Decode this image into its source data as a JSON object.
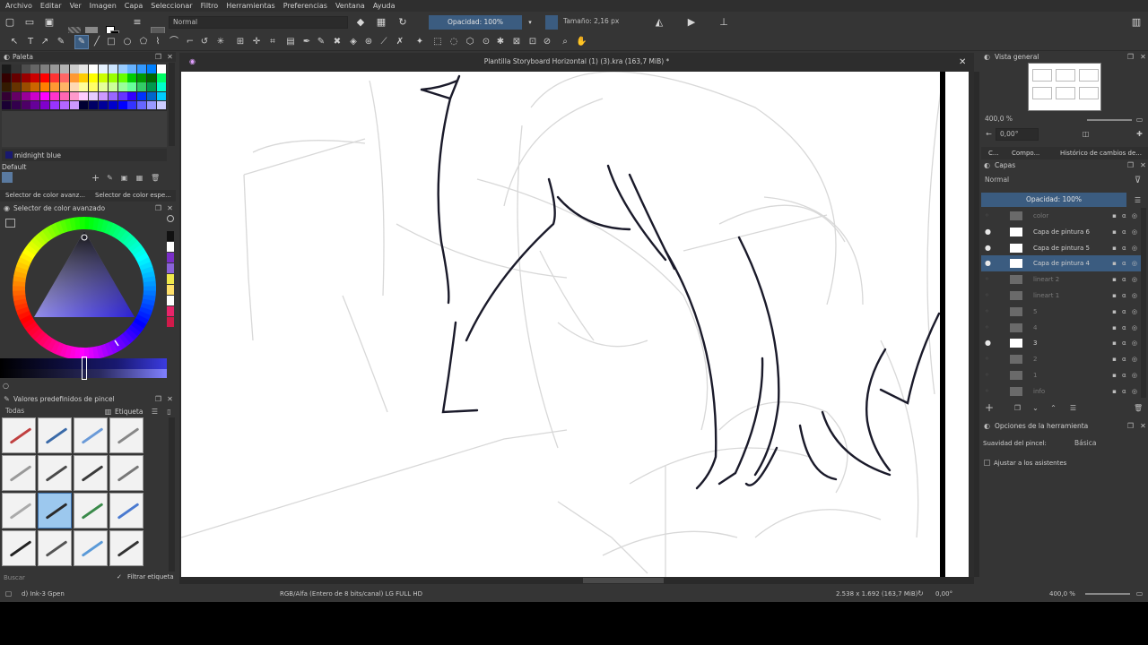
{
  "menu": [
    "Archivo",
    "Editar",
    "Ver",
    "Imagen",
    "Capa",
    "Seleccionar",
    "Filtro",
    "Herramientas",
    "Preferencias",
    "Ventana",
    "Ayuda"
  ],
  "toolbar": {
    "blend_mode": "Normal",
    "opacity": "Opacidad: 100%",
    "size": "Tamaño: 2,16 px"
  },
  "document": {
    "title": "Plantilla Storyboard Horizontal (1) (3).kra (163,7 MiB) *",
    "close": "✕"
  },
  "palette": {
    "title": "Paleta",
    "color_name": "midnight blue",
    "set_name": "Default",
    "swatch_rows": [
      [
        "#1a1a1a",
        "#333333",
        "#4d4d4d",
        "#666666",
        "#808080",
        "#999999",
        "#b3b3b3",
        "#cccccc",
        "#e6e6e6",
        "#ffffff",
        "#e6f2ff",
        "#cce5ff",
        "#99ccff",
        "#66b2ff",
        "#3399ff",
        "#0080ff",
        "#ffffff"
      ],
      [
        "#330000",
        "#660000",
        "#990000",
        "#cc0000",
        "#ff0000",
        "#ff3333",
        "#ff6666",
        "#ff9933",
        "#ffcc00",
        "#ffff00",
        "#ccff00",
        "#99ff00",
        "#66ff00",
        "#00cc00",
        "#009900",
        "#006600",
        "#00ff66"
      ],
      [
        "#331a00",
        "#663300",
        "#994d00",
        "#cc6600",
        "#ff8000",
        "#ff9933",
        "#ffb366",
        "#ffd9b3",
        "#ffff99",
        "#ffff66",
        "#e6ff99",
        "#ccff99",
        "#99ff99",
        "#66ff99",
        "#33cc66",
        "#00994d",
        "#00ffcc"
      ],
      [
        "#330033",
        "#660066",
        "#990099",
        "#cc00cc",
        "#ff00ff",
        "#ff33cc",
        "#ff66b3",
        "#ff99cc",
        "#ffccff",
        "#e6ccff",
        "#cc99ff",
        "#9966ff",
        "#6633ff",
        "#3300ff",
        "#0033ff",
        "#0066cc",
        "#00ccff"
      ],
      [
        "#1a0033",
        "#33004d",
        "#4d0066",
        "#660099",
        "#8000cc",
        "#9933ff",
        "#b366ff",
        "#cc99ff",
        "#000033",
        "#000066",
        "#000099",
        "#0000cc",
        "#0000ff",
        "#3333ff",
        "#6666ff",
        "#9999ff",
        "#ccccff"
      ]
    ]
  },
  "color_selector": {
    "tabs": [
      "Selector de color avanz...",
      "Selector de color espe..."
    ],
    "title": "Selector de color avanzado",
    "side_swatches": [
      "#111111",
      "#ffffff",
      "#7a2fc8",
      "#8a63d8",
      "#f0e84a",
      "#ffe06a",
      "#ffffff",
      "#e8246a",
      "#d01a4a"
    ]
  },
  "brushes": {
    "title": "Valores predefinidos de pincel",
    "filter_all": "Todas",
    "tag_label": "Etiqueta",
    "search_placeholder": "Buscar",
    "filter_tag": "Filtrar etiqueta"
  },
  "overview": {
    "title": "Vista general",
    "zoom": "400,0 %",
    "rotation": "0,00°"
  },
  "layers_tabs": [
    "C...",
    "Compo...",
    "Histórico de cambios de..."
  ],
  "layers": {
    "title": "Capas",
    "blend": "Normal",
    "opacity": "Opacidad: 100%",
    "items": [
      {
        "name": "color",
        "visible": false
      },
      {
        "name": "Capa de pintura 6",
        "visible": true
      },
      {
        "name": "Capa de pintura 5",
        "visible": true
      },
      {
        "name": "Capa de pintura 4",
        "visible": true,
        "selected": true
      },
      {
        "name": "lineart 2",
        "visible": false
      },
      {
        "name": "lineart 1",
        "visible": false
      },
      {
        "name": "5",
        "visible": false
      },
      {
        "name": "4",
        "visible": false
      },
      {
        "name": "3",
        "visible": true
      },
      {
        "name": "2",
        "visible": false
      },
      {
        "name": "1",
        "visible": false
      },
      {
        "name": "info",
        "visible": false
      }
    ]
  },
  "tool_options": {
    "title": "Opciones de la herramienta",
    "smoothing_label": "Suavidad del pincel:",
    "smoothing_value": "Básica",
    "assistants": "Ajustar a los asistentes"
  },
  "status": {
    "brush": "d) Ink-3 Gpen",
    "color_space": "RGB/Alfa (Entero de 8 bits/canal) LG FULL HD",
    "dimensions": "2.538 x 1.692 (163,7 MiB)",
    "rotation": "0,00°",
    "zoom": "400,0 %"
  }
}
